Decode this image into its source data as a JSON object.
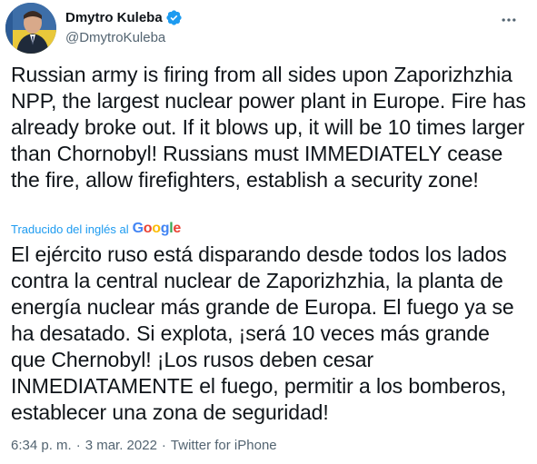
{
  "author": {
    "display_name": "Dmytro Kuleba",
    "handle": "@DmytroKuleba",
    "verified_color": "#1d9bf0"
  },
  "tweet": {
    "text": "Russian army is firing from all sides upon Zaporizhzhia NPP, the largest nuclear power plant in Europe. Fire has already broke out. If it blows up, it will be 10 times larger than Chornobyl! Russians must IMMEDIATELY cease the fire, allow firefighters, establish a security zone!",
    "translated_label": "Traducido del inglés al",
    "translation_provider": {
      "letters": [
        "G",
        "o",
        "o",
        "g",
        "l",
        "e"
      ]
    },
    "translated_text": "El ejército ruso está disparando desde todos los lados contra la central nuclear de Zaporizhzhia, la planta de energía nuclear más grande de Europa. El fuego ya se ha desatado. Si explota, ¡será 10 veces más grande que Chernobyl! ¡Los rusos deben cesar INMEDIATAMENTE el fuego, permitir a los bomberos, establecer una zona de seguridad!"
  },
  "meta": {
    "time": "6:34 p. m.",
    "separator": "·",
    "date": "3 mar. 2022",
    "source": "Twitter for iPhone"
  },
  "icons": {
    "verified": "verified-badge-icon",
    "more": "more-options-icon"
  },
  "colors": {
    "link": "#1d9bf0",
    "secondary_text": "#536471",
    "primary_text": "#0f1419"
  }
}
